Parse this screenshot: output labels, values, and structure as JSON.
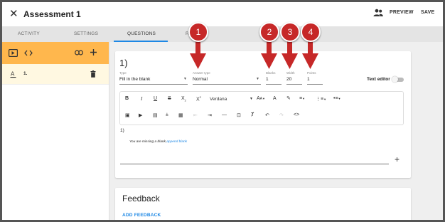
{
  "header": {
    "title": "Assessment 1",
    "preview_label": "PREVIEW",
    "save_label": "SAVE",
    "close_icon": "close-icon",
    "people_icon": "people-icon"
  },
  "tabs": [
    {
      "label": "ACTIVITY",
      "active": false
    },
    {
      "label": "SETTINGS",
      "active": false
    },
    {
      "label": "QUESTIONS",
      "active": true
    },
    {
      "label": "R",
      "active": false
    }
  ],
  "sidebar": {
    "header_icons": [
      "video-icon",
      "code-icon",
      "link-icon",
      "plus-icon"
    ],
    "items": [
      {
        "type_icon": "text-format-icon",
        "label": "1.",
        "delete_icon": "trash-icon"
      }
    ]
  },
  "question": {
    "number": "1)",
    "type_label": "Type",
    "type_value": "Fill in the blank",
    "answer_type_label": "Answer type",
    "answer_type_value": "Normal",
    "blanks_label": "Blanks",
    "blanks_value": "1",
    "width_label": "Width",
    "width_value": "20",
    "points_label": "Points",
    "points_value": "1",
    "text_editor_label": "Text editor",
    "text_editor_on": false,
    "editor": {
      "font_name": "Verdana",
      "body_text": "1)",
      "missing_message": "You are missing a blank,",
      "append_link": "append blank"
    }
  },
  "feedback": {
    "title": "Feedback",
    "add_label": "ADD FEEDBACK"
  },
  "callouts": [
    "1",
    "2",
    "3",
    "4"
  ],
  "colors": {
    "accent": "#1e88e5",
    "sidebar_header": "#ffb74d",
    "sidebar_selected": "#fff8e1",
    "callout": "#c62828"
  }
}
